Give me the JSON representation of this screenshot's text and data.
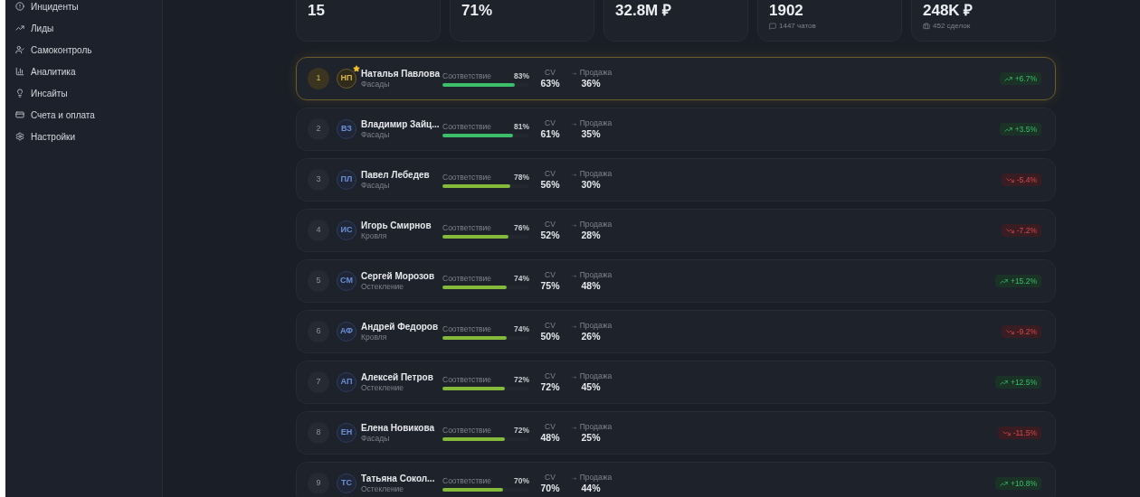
{
  "sidebar": {
    "items": [
      {
        "label": "Инциденты"
      },
      {
        "label": "Лиды"
      },
      {
        "label": "Самоконтроль"
      },
      {
        "label": "Аналитика"
      },
      {
        "label": "Инсайты"
      },
      {
        "label": "Счета и оплата"
      },
      {
        "label": "Настройки"
      }
    ]
  },
  "stats": [
    {
      "value": "15"
    },
    {
      "value": "71%"
    },
    {
      "value": "32.8M ₽"
    },
    {
      "value": "1902",
      "note": "1447 чатов"
    },
    {
      "value": "248K ₽",
      "note": "452 сделок"
    }
  ],
  "ranking": [
    {
      "rank": "1",
      "initials": "НП",
      "name": "Наталья Павлова",
      "team": "Фасады",
      "compliance_label": "Соответствие",
      "compliance": "83%",
      "level": 0.83,
      "color": "#3cbf6a",
      "cv_label": "CV",
      "cv": "63%",
      "sale_label": "→ Продажа",
      "sale": "36%",
      "kind": "up",
      "change": "+6.7%",
      "leader": true
    },
    {
      "rank": "2",
      "initials": "ВЗ",
      "name": "Владимир Зайц...",
      "team": "Фасады",
      "compliance_label": "Соответствие",
      "compliance": "81%",
      "level": 0.81,
      "color": "#3cbf6a",
      "cv_label": "CV",
      "cv": "61%",
      "sale_label": "→ Продажа",
      "sale": "35%",
      "kind": "up",
      "change": "+3.5%",
      "leader": false
    },
    {
      "rank": "3",
      "initials": "ПЛ",
      "name": "Павел Лебедев",
      "team": "Фасады",
      "compliance_label": "Соответствие",
      "compliance": "78%",
      "level": 0.78,
      "color": "#84bb3b",
      "cv_label": "CV",
      "cv": "56%",
      "sale_label": "→ Продажа",
      "sale": "30%",
      "kind": "down",
      "change": "-5.4%",
      "leader": false
    },
    {
      "rank": "4",
      "initials": "ИС",
      "name": "Игорь Смирнов",
      "team": "Кровля",
      "compliance_label": "Соответствие",
      "compliance": "76%",
      "level": 0.76,
      "color": "#84bb3b",
      "cv_label": "CV",
      "cv": "52%",
      "sale_label": "→ Продажа",
      "sale": "28%",
      "kind": "down",
      "change": "-7.2%",
      "leader": false
    },
    {
      "rank": "5",
      "initials": "СМ",
      "name": "Сергей Морозов",
      "team": "Остекление",
      "compliance_label": "Соответствие",
      "compliance": "74%",
      "level": 0.74,
      "color": "#84bb3b",
      "cv_label": "CV",
      "cv": "75%",
      "sale_label": "→ Продажа",
      "sale": "48%",
      "kind": "up",
      "change": "+15.2%",
      "leader": false
    },
    {
      "rank": "6",
      "initials": "АФ",
      "name": "Андрей Федоров",
      "team": "Кровля",
      "compliance_label": "Соответствие",
      "compliance": "74%",
      "level": 0.74,
      "color": "#84bb3b",
      "cv_label": "CV",
      "cv": "50%",
      "sale_label": "→ Продажа",
      "sale": "26%",
      "kind": "down",
      "change": "-9.2%",
      "leader": false
    },
    {
      "rank": "7",
      "initials": "АП",
      "name": "Алексей Петров",
      "team": "Остекление",
      "compliance_label": "Соответствие",
      "compliance": "72%",
      "level": 0.72,
      "color": "#84bb3b",
      "cv_label": "CV",
      "cv": "72%",
      "sale_label": "→ Продажа",
      "sale": "45%",
      "kind": "up",
      "change": "+12.5%",
      "leader": false
    },
    {
      "rank": "8",
      "initials": "ЕН",
      "name": "Елена Новикова",
      "team": "Фасады",
      "compliance_label": "Соответствие",
      "compliance": "72%",
      "level": 0.72,
      "color": "#84bb3b",
      "cv_label": "CV",
      "cv": "48%",
      "sale_label": "→ Продажа",
      "sale": "25%",
      "kind": "down",
      "change": "-11.5%",
      "leader": false
    },
    {
      "rank": "9",
      "initials": "ТС",
      "name": "Татьяна Сокол...",
      "team": "Остекление",
      "compliance_label": "Соответствие",
      "compliance": "70%",
      "level": 0.7,
      "color": "#84bb3b",
      "cv_label": "CV",
      "cv": "70%",
      "sale_label": "→ Продажа",
      "sale": "44%",
      "kind": "up",
      "change": "+10.8%",
      "leader": false
    }
  ]
}
